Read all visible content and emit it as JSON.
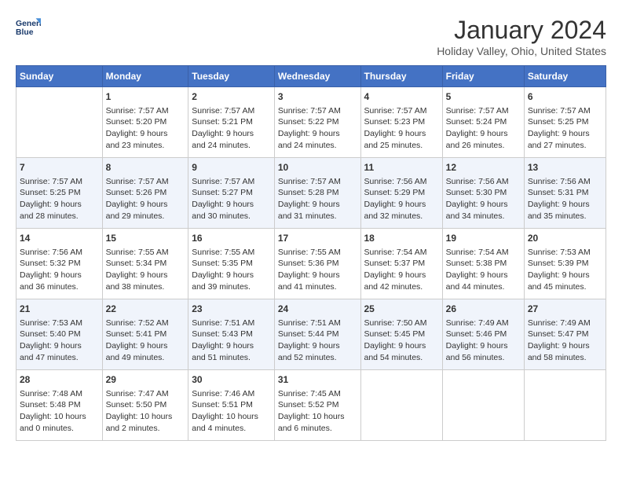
{
  "header": {
    "logo_line1": "General",
    "logo_line2": "Blue",
    "month": "January 2024",
    "location": "Holiday Valley, Ohio, United States"
  },
  "days_of_week": [
    "Sunday",
    "Monday",
    "Tuesday",
    "Wednesday",
    "Thursday",
    "Friday",
    "Saturday"
  ],
  "weeks": [
    [
      {
        "day": "",
        "info": ""
      },
      {
        "day": "1",
        "info": "Sunrise: 7:57 AM\nSunset: 5:20 PM\nDaylight: 9 hours\nand 23 minutes."
      },
      {
        "day": "2",
        "info": "Sunrise: 7:57 AM\nSunset: 5:21 PM\nDaylight: 9 hours\nand 24 minutes."
      },
      {
        "day": "3",
        "info": "Sunrise: 7:57 AM\nSunset: 5:22 PM\nDaylight: 9 hours\nand 24 minutes."
      },
      {
        "day": "4",
        "info": "Sunrise: 7:57 AM\nSunset: 5:23 PM\nDaylight: 9 hours\nand 25 minutes."
      },
      {
        "day": "5",
        "info": "Sunrise: 7:57 AM\nSunset: 5:24 PM\nDaylight: 9 hours\nand 26 minutes."
      },
      {
        "day": "6",
        "info": "Sunrise: 7:57 AM\nSunset: 5:25 PM\nDaylight: 9 hours\nand 27 minutes."
      }
    ],
    [
      {
        "day": "7",
        "info": "Sunrise: 7:57 AM\nSunset: 5:25 PM\nDaylight: 9 hours\nand 28 minutes."
      },
      {
        "day": "8",
        "info": "Sunrise: 7:57 AM\nSunset: 5:26 PM\nDaylight: 9 hours\nand 29 minutes."
      },
      {
        "day": "9",
        "info": "Sunrise: 7:57 AM\nSunset: 5:27 PM\nDaylight: 9 hours\nand 30 minutes."
      },
      {
        "day": "10",
        "info": "Sunrise: 7:57 AM\nSunset: 5:28 PM\nDaylight: 9 hours\nand 31 minutes."
      },
      {
        "day": "11",
        "info": "Sunrise: 7:56 AM\nSunset: 5:29 PM\nDaylight: 9 hours\nand 32 minutes."
      },
      {
        "day": "12",
        "info": "Sunrise: 7:56 AM\nSunset: 5:30 PM\nDaylight: 9 hours\nand 34 minutes."
      },
      {
        "day": "13",
        "info": "Sunrise: 7:56 AM\nSunset: 5:31 PM\nDaylight: 9 hours\nand 35 minutes."
      }
    ],
    [
      {
        "day": "14",
        "info": "Sunrise: 7:56 AM\nSunset: 5:32 PM\nDaylight: 9 hours\nand 36 minutes."
      },
      {
        "day": "15",
        "info": "Sunrise: 7:55 AM\nSunset: 5:34 PM\nDaylight: 9 hours\nand 38 minutes."
      },
      {
        "day": "16",
        "info": "Sunrise: 7:55 AM\nSunset: 5:35 PM\nDaylight: 9 hours\nand 39 minutes."
      },
      {
        "day": "17",
        "info": "Sunrise: 7:55 AM\nSunset: 5:36 PM\nDaylight: 9 hours\nand 41 minutes."
      },
      {
        "day": "18",
        "info": "Sunrise: 7:54 AM\nSunset: 5:37 PM\nDaylight: 9 hours\nand 42 minutes."
      },
      {
        "day": "19",
        "info": "Sunrise: 7:54 AM\nSunset: 5:38 PM\nDaylight: 9 hours\nand 44 minutes."
      },
      {
        "day": "20",
        "info": "Sunrise: 7:53 AM\nSunset: 5:39 PM\nDaylight: 9 hours\nand 45 minutes."
      }
    ],
    [
      {
        "day": "21",
        "info": "Sunrise: 7:53 AM\nSunset: 5:40 PM\nDaylight: 9 hours\nand 47 minutes."
      },
      {
        "day": "22",
        "info": "Sunrise: 7:52 AM\nSunset: 5:41 PM\nDaylight: 9 hours\nand 49 minutes."
      },
      {
        "day": "23",
        "info": "Sunrise: 7:51 AM\nSunset: 5:43 PM\nDaylight: 9 hours\nand 51 minutes."
      },
      {
        "day": "24",
        "info": "Sunrise: 7:51 AM\nSunset: 5:44 PM\nDaylight: 9 hours\nand 52 minutes."
      },
      {
        "day": "25",
        "info": "Sunrise: 7:50 AM\nSunset: 5:45 PM\nDaylight: 9 hours\nand 54 minutes."
      },
      {
        "day": "26",
        "info": "Sunrise: 7:49 AM\nSunset: 5:46 PM\nDaylight: 9 hours\nand 56 minutes."
      },
      {
        "day": "27",
        "info": "Sunrise: 7:49 AM\nSunset: 5:47 PM\nDaylight: 9 hours\nand 58 minutes."
      }
    ],
    [
      {
        "day": "28",
        "info": "Sunrise: 7:48 AM\nSunset: 5:48 PM\nDaylight: 10 hours\nand 0 minutes."
      },
      {
        "day": "29",
        "info": "Sunrise: 7:47 AM\nSunset: 5:50 PM\nDaylight: 10 hours\nand 2 minutes."
      },
      {
        "day": "30",
        "info": "Sunrise: 7:46 AM\nSunset: 5:51 PM\nDaylight: 10 hours\nand 4 minutes."
      },
      {
        "day": "31",
        "info": "Sunrise: 7:45 AM\nSunset: 5:52 PM\nDaylight: 10 hours\nand 6 minutes."
      },
      {
        "day": "",
        "info": ""
      },
      {
        "day": "",
        "info": ""
      },
      {
        "day": "",
        "info": ""
      }
    ]
  ]
}
